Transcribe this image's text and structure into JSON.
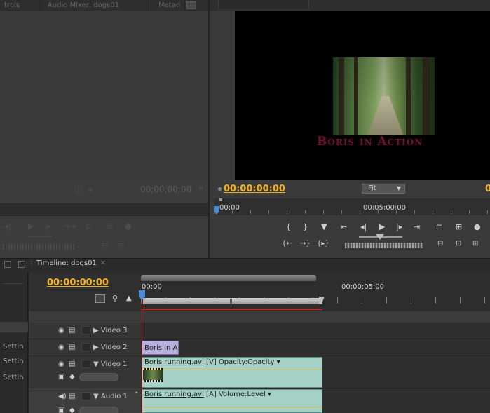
{
  "colors": {
    "accent_timecode": "#f2b11d",
    "video_clip": "#a4d0c5",
    "title_clip": "#b9b0df",
    "playhead_line": "#d63c3c",
    "title_text": "#6b1434"
  },
  "source_panel": {
    "tabs": [
      "trols",
      "Audio Mixer: dogs01",
      "Metad"
    ],
    "timecode": "00;00;00;00",
    "timecode_icon": "tc-toggle-icon",
    "left_labels": [
      "Settin",
      "Settin",
      "Settin"
    ]
  },
  "program_monitor": {
    "video_title_text": "Boris in Action",
    "timecode": "00:00:00:00",
    "fit_select": "Fit",
    "fit_arrow": "▼",
    "right_timecode_partial": "0",
    "ruler_start": "00:00",
    "ruler_mid": "00:05:00:00"
  },
  "timeline": {
    "tab_label": "Timeline: dogs01",
    "tab_close": "×",
    "timecode": "00:00:00:00",
    "ruler_start": "00:00",
    "ruler_mid": "00:00:05:00",
    "tracks": [
      {
        "name": "Video 3",
        "expand": "▶"
      },
      {
        "name": "Video 2",
        "expand": "▶"
      },
      {
        "name": "Video 1",
        "expand": "▼"
      },
      {
        "name": "Audio 1",
        "expand": "▼"
      }
    ],
    "clips": {
      "title_clip": "Boris in A",
      "video_clip_name": "Boris running.avi",
      "video_clip_suffix": " [V] Opacity:Opacity ▾",
      "audio_clip_name": "Boris running.avi",
      "audio_clip_suffix": " [A] Volume:Level ▾"
    }
  }
}
